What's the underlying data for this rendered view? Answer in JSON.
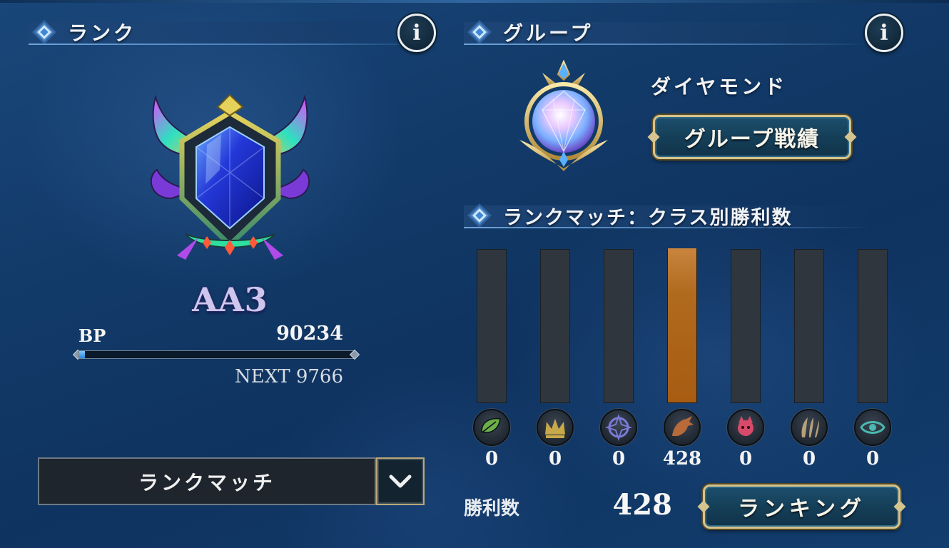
{
  "rank": {
    "section_title": "ランク",
    "rank_name": "AA3",
    "bp_label": "BP",
    "bp_value": "90234",
    "bp_progress": 0.02,
    "next_text": "NEXT 9766",
    "mode_select": {
      "selected": "ランクマッチ"
    }
  },
  "group": {
    "section_title": "グループ",
    "group_name": "ダイヤモンド",
    "results_button": "グループ戦績"
  },
  "class_wins": {
    "section_title": "ランクマッチ：クラス別勝利数",
    "classes": [
      {
        "icon": "leaf-icon",
        "count": "0",
        "value": 0,
        "color": "#6cae4a"
      },
      {
        "icon": "crown-icon",
        "count": "0",
        "value": 0,
        "color": "#c7a84a"
      },
      {
        "icon": "rune-circle-icon",
        "count": "0",
        "value": 0,
        "color": "#7a7ad8"
      },
      {
        "icon": "dragon-icon",
        "count": "428",
        "value": 428,
        "color": "#b86a3a"
      },
      {
        "icon": "bat-icon",
        "count": "0",
        "value": 0,
        "color": "#d84a6a"
      },
      {
        "icon": "claw-icon",
        "count": "0",
        "value": 0,
        "color": "#b8a07a"
      },
      {
        "icon": "eye-swirl-icon",
        "count": "0",
        "value": 0,
        "color": "#4ab8b0"
      }
    ],
    "max_value": 428,
    "wins_label": "勝利数",
    "wins_total": "428",
    "ranking_button": "ランキング"
  }
}
